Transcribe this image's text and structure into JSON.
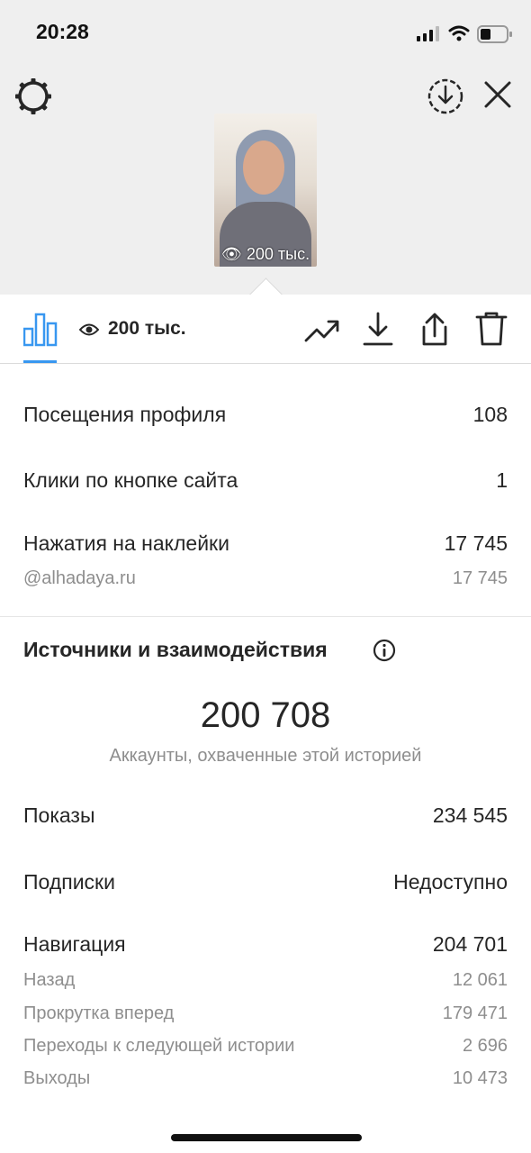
{
  "status_bar": {
    "time": "20:28"
  },
  "story": {
    "thumbnail_views": "200 тыс."
  },
  "toolbar": {
    "views": "200 тыс.",
    "icons": [
      "bar-chart-icon",
      "eye-icon",
      "trending-icon",
      "download-icon",
      "share-icon",
      "trash-icon"
    ]
  },
  "metrics": {
    "profile_visits": {
      "label": "Посещения профиля",
      "value": "108"
    },
    "website_clicks": {
      "label": "Клики по кнопке сайта",
      "value": "1"
    },
    "sticker_taps": {
      "label": "Нажатия на наклейки",
      "value": "17 745"
    },
    "mention": {
      "label": "@alhadaya.ru",
      "value": "17 745"
    }
  },
  "interactions": {
    "title": "Источники и взаимодействия",
    "reach_value": "200 708",
    "reach_caption": "Аккаунты, охваченные этой историей",
    "impressions": {
      "label": "Показы",
      "value": "234 545"
    },
    "follows": {
      "label": "Подписки",
      "value": "Недоступно"
    },
    "navigation": {
      "label": "Навигация",
      "value": "204 701"
    },
    "nav_items": [
      {
        "label": "Назад",
        "value": "12 061"
      },
      {
        "label": "Прокрутка вперед",
        "value": "179 471"
      },
      {
        "label": "Переходы к следующей истории",
        "value": "2 696"
      },
      {
        "label": "Выходы",
        "value": "10 473"
      }
    ]
  },
  "colors": {
    "accent": "#3897f0",
    "text": "#262626",
    "secondary": "#8e8e8e",
    "header_bg": "#efefef"
  }
}
